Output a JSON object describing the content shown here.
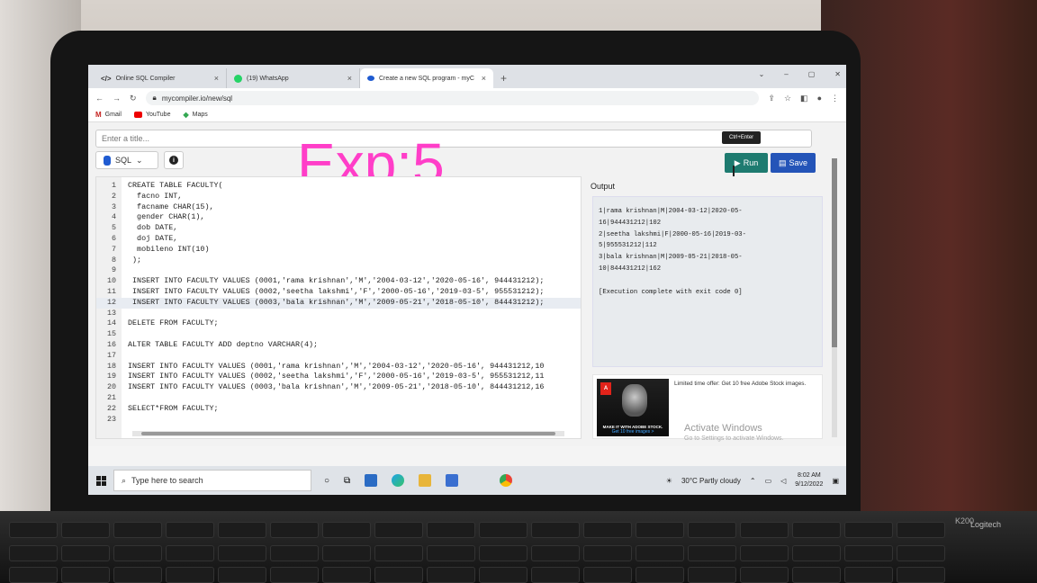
{
  "browser": {
    "tabs": [
      {
        "label": "Online SQL Compiler",
        "icon": "code-icon"
      },
      {
        "label": "(19) WhatsApp",
        "icon": "whatsapp-icon"
      },
      {
        "label": "Create a new SQL program - myC",
        "icon": "mycompiler-icon",
        "active": true
      }
    ],
    "new_tab": "+",
    "url": "mycompiler.io/new/sql",
    "bookmarks": [
      "Gmail",
      "YouTube",
      "Maps"
    ]
  },
  "page": {
    "title_placeholder": "Enter a title...",
    "language": "SQL",
    "overlay_text": "Exp:5",
    "tooltip": "Ctrl+Enter",
    "run_label": "Run",
    "save_label": "Save",
    "output_label": "Output"
  },
  "editor": {
    "lines": [
      {
        "n": "1",
        "code": "CREATE TABLE FACULTY("
      },
      {
        "n": "2",
        "code": "  facno INT,"
      },
      {
        "n": "3",
        "code": "  facname CHAR(15),"
      },
      {
        "n": "4",
        "code": "  gender CHAR(1),"
      },
      {
        "n": "5",
        "code": "  dob DATE,"
      },
      {
        "n": "6",
        "code": "  doj DATE,"
      },
      {
        "n": "7",
        "code": "  mobileno INT(10)"
      },
      {
        "n": "8",
        "code": " );"
      },
      {
        "n": "9",
        "code": ""
      },
      {
        "n": "10",
        "code": " INSERT INTO FACULTY VALUES (0001,'rama krishnan','M','2004-03-12','2020-05-16', 944431212);"
      },
      {
        "n": "11",
        "code": " INSERT INTO FACULTY VALUES (0002,'seetha lakshmi','F','2000-05-16','2019-03-5', 955531212);"
      },
      {
        "n": "12",
        "code": " INSERT INTO FACULTY VALUES (0003,'bala krishnan','M','2009-05-21','2018-05-10', 844431212);",
        "highlight": true
      },
      {
        "n": "13",
        "code": ""
      },
      {
        "n": "14",
        "code": "DELETE FROM FACULTY;"
      },
      {
        "n": "15",
        "code": ""
      },
      {
        "n": "16",
        "code": "ALTER TABLE FACULTY ADD deptno VARCHAR(4);"
      },
      {
        "n": "17",
        "code": ""
      },
      {
        "n": "18",
        "code": "INSERT INTO FACULTY VALUES (0001,'rama krishnan','M','2004-03-12','2020-05-16', 944431212,10"
      },
      {
        "n": "19",
        "code": "INSERT INTO FACULTY VALUES (0002,'seetha lakshmi','F','2000-05-16','2019-03-5', 955531212,11"
      },
      {
        "n": "20",
        "code": "INSERT INTO FACULTY VALUES (0003,'bala krishnan','M','2009-05-21','2018-05-10', 844431212,16"
      },
      {
        "n": "21",
        "code": ""
      },
      {
        "n": "22",
        "code": "SELECT*FROM FACULTY;"
      },
      {
        "n": "23",
        "code": ""
      }
    ]
  },
  "output": {
    "lines": [
      "1|rama krishnan|M|2004-03-12|2020-05-",
      "16|944431212|102",
      "2|seetha lakshmi|F|2000-05-16|2019-03-",
      "5|955531212|112",
      "3|bala krishnan|M|2009-05-21|2018-05-",
      "10|844431212|162",
      "",
      "[Execution complete with exit code 0]"
    ]
  },
  "ad": {
    "text": "Limited time offer: Get 10 free Adobe Stock images.",
    "cta": "MAKE IT WITH ADOBE STOCK.",
    "sub": "Get 10 free images >"
  },
  "watermark": {
    "title": "Activate Windows",
    "subtitle": "Go to Settings to activate Windows."
  },
  "taskbar": {
    "search_placeholder": "Type here to search",
    "weather": "30°C  Partly cloudy",
    "time": "8:02 AM",
    "date": "9/12/2022"
  },
  "keyboard": {
    "brand": "K200",
    "maker": "Logitech"
  }
}
